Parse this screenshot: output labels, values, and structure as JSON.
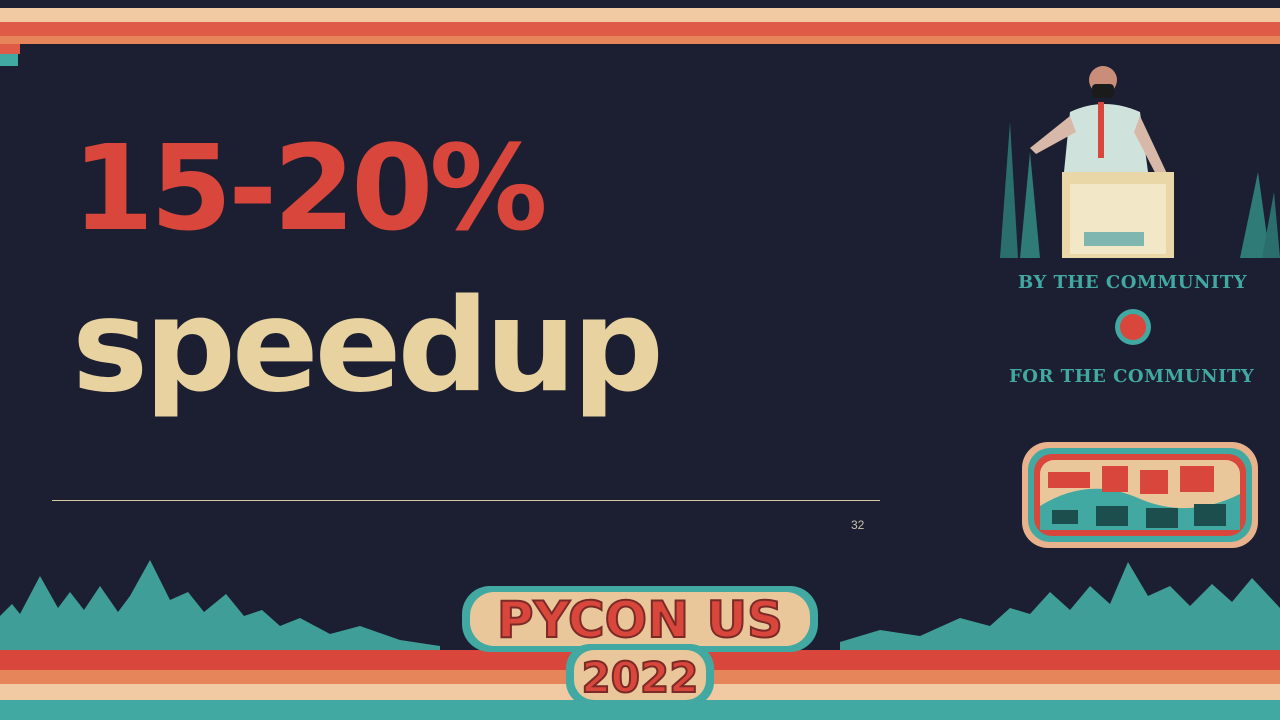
{
  "slide": {
    "headline_line1": "15-20%",
    "headline_line2": "speedup",
    "slide_number": "32"
  },
  "sidebar": {
    "motto_top": "BY THE COMMUNITY",
    "motto_bottom": "FOR THE COMMUNITY"
  },
  "banner": {
    "event_name": "PYCON US",
    "event_year": "2022"
  },
  "colors": {
    "background": "#1c1f31",
    "accent_red": "#d9463c",
    "accent_cream": "#e8d3a0",
    "accent_teal": "#41a8a2"
  }
}
